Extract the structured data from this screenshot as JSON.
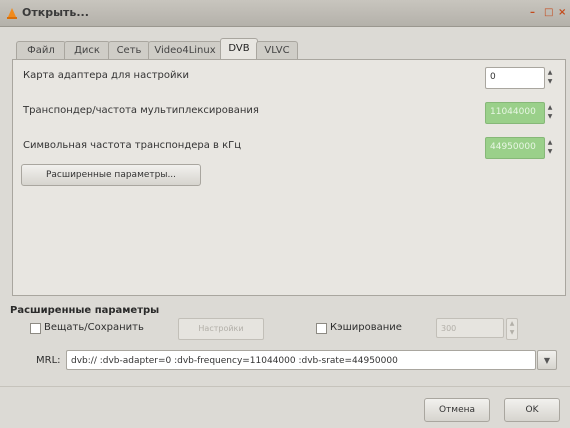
{
  "window": {
    "title": "Открыть...",
    "minimize": "–",
    "maximize": "□",
    "close": "×"
  },
  "tabs": [
    {
      "label": "Файл",
      "active": false
    },
    {
      "label": "Диск",
      "active": false
    },
    {
      "label": "Сеть",
      "active": false
    },
    {
      "label": "Video4Linux",
      "active": false
    },
    {
      "label": "DVB",
      "active": true
    },
    {
      "label": "VLVC",
      "active": false
    }
  ],
  "dvb": {
    "adapter_label": "Карта адаптера для настройки",
    "adapter_value": "0",
    "frequency_label": "Транспондер/частота мультиплексирования",
    "frequency_value": "11044000",
    "srate_label": "Символьная частота транспондера в кГц",
    "srate_value": "44950000",
    "advanced_button": "Расширенные параметры..."
  },
  "advanced": {
    "title": "Расширенные параметры",
    "stream_label": "Вещать/Сохранить",
    "stream_checked": false,
    "settings_button": "Настройки",
    "cache_label": "Кэширование",
    "cache_checked": false,
    "cache_value": "300",
    "mrl_label": "MRL:",
    "mrl_value": "dvb:// :dvb-adapter=0 :dvb-frequency=11044000 :dvb-srate=44950000"
  },
  "buttons": {
    "cancel": "Отмена",
    "ok": "OK"
  },
  "colors": {
    "accent_green": "#9ad08a",
    "close_red": "#c44a1a"
  }
}
